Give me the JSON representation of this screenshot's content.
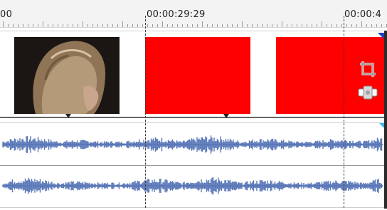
{
  "ruler": {
    "labels": [
      "00",
      "00:00:29:29",
      "00:00:4"
    ]
  },
  "video_track": {
    "events": [
      {
        "type": "thumbnail",
        "content": "video frame of a person with blonde hair"
      },
      {
        "type": "solid-color",
        "color": "#ff0000"
      },
      {
        "type": "solid-color",
        "color": "#ff0000"
      }
    ],
    "icons": [
      "crop-icon",
      "event-fx-icon"
    ]
  },
  "audio_track": {
    "channels": 2,
    "waveform_color": "#5a78b8"
  }
}
